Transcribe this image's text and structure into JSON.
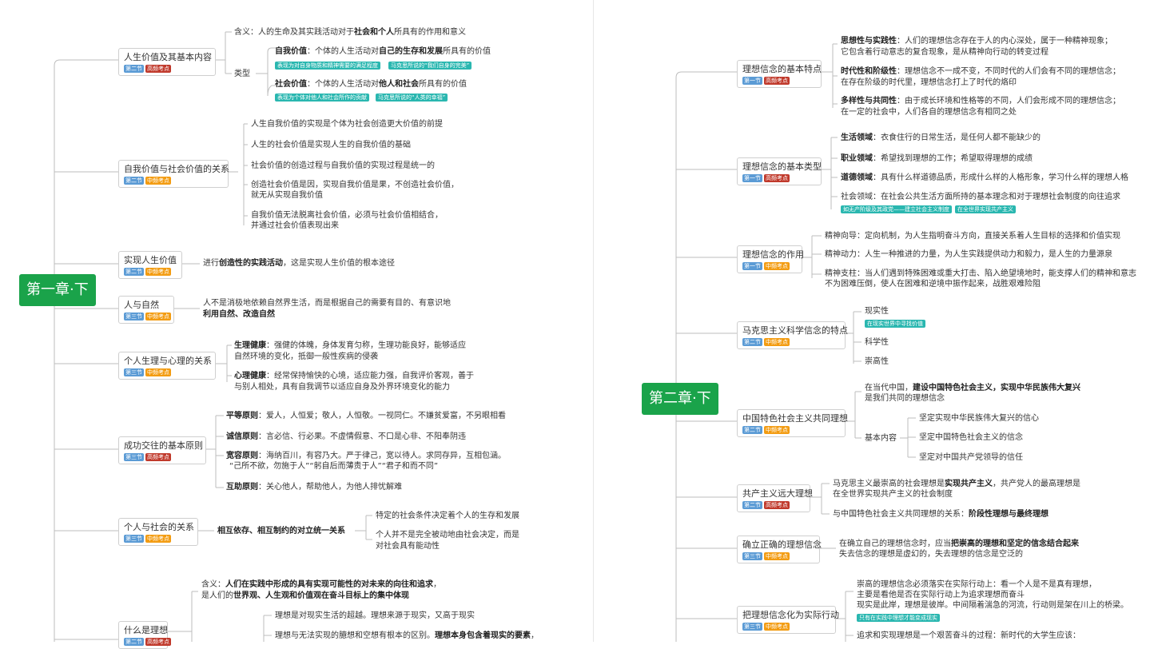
{
  "badges": {
    "s1": "第一节",
    "s2": "第二节",
    "s3": "第三节",
    "high": "高频考点",
    "mid": "中频考点"
  },
  "colors": {
    "root": "#1aa34a",
    "high": "#c0392b",
    "mid": "#f39c12",
    "section": "#5b9bd5",
    "tag": "#2ab7b0"
  },
  "left": {
    "root": "第一章·下",
    "n1": {
      "title": "人生价值及其基本内容",
      "meaning_pre": "含义：人的生命及其实践活动对于",
      "meaning_bold": "社会和个人",
      "meaning_post": "所具有的作用和意义",
      "types_label": "类型",
      "self_bold": "自我价值",
      "self_mid": "：个体的人生活动对",
      "self_bold2": "自己的生存和发展",
      "self_post": "所具有的价值",
      "self_tag1": "表现为对自身物质和精神需要的满足程度",
      "self_tag2": "马克思所说的“我们自身的完美”",
      "soc_bold": "社会价值",
      "soc_mid": "：个体的人生活动对",
      "soc_bold2": "他人和社会",
      "soc_post": "所具有的价值",
      "soc_tag1": "表现为个体对他人和社会所作的贡献",
      "soc_tag2": "马克思所说的“人类的幸福”"
    },
    "n2": {
      "title": "自我价值与社会价值的关系",
      "i1": "人生自我价值的实现是个体为社会创造更大价值的前提",
      "i2": "人生的社会价值是实现人生的自我价值的基础",
      "i3": "社会价值的创造过程与自我价值的实现过程是统一的",
      "i4a": "创造社会价值是因，实现自我价值是果，不创造社会价值，",
      "i4b": "就无从实现自我价值",
      "i5a": "自我价值无法脱离社会价值，必须与社会价值相结合，",
      "i5b": "并通过社会价值表现出来"
    },
    "n3": {
      "title": "实现人生价值",
      "pre": "进行",
      "bold": "创造性的实践活动",
      "post": "，这是实现人生价值的根本途径"
    },
    "n4": {
      "title": "人与自然",
      "l1": "人不是消极地依赖自然界生活，而是根据自己的需要有目的、有意识地",
      "l2": "利用自然、改造自然"
    },
    "n5": {
      "title": "个人生理与心理的关系",
      "a_bold": "生理健康",
      "a_l1": "：强健的体魄，身体发育匀称，生理功能良好，能够适应",
      "a_l2": "自然环境的变化，抵御一般性疾病的侵袭",
      "b_bold": "心理健康",
      "b_l1": "：经常保持愉快的心境，适应能力强，自我评价客观，善于",
      "b_l2": "与别人相处，具有自我调节以适应自身及外界环境变化的能力"
    },
    "n6": {
      "title": "成功交往的基本原则",
      "p1_bold": "平等原则",
      "p1": "：爱人，人恒爱；敬人，人恒敬。一视同仁。不嫌贫爱富，不另眼相看",
      "p2_bold": "诚信原则",
      "p2": "：言必信、行必果。不虚情假意、不口是心非、不阳奉阴违",
      "p3_bold": "宽容原则",
      "p3": "：海纳百川，有容乃大。严于律己，宽以待人。求同存异，互相包涵。",
      "p3b": "“己所不欲，勿施于人”“躬自后而薄责于人”“君子和而不同”",
      "p4_bold": "互助原则",
      "p4": "：关心他人，帮助他人，为他人排忧解难"
    },
    "n7": {
      "title": "个人与社会的关系",
      "mid": "相互依存、相互制约的对立统一关系",
      "i1": "特定的社会条件决定着个人的生存和发展",
      "i2a": "个人并不是完全被动地由社会决定，而是",
      "i2b": "对社会具有能动性"
    },
    "n8": {
      "title": "什么是理想",
      "m_pre": "含义：",
      "m_bold": "人们在实践中形成的具有实现可能性的对未来的向往和追求",
      "m_post": "，",
      "m2_pre": "是人们的",
      "m2_bold": "世界观、人生观和价值观在奋斗目标上的集中体现",
      "i1": "理想是对现实生活的超越。理想来源于现实，又高于现实",
      "i2_pre": "理想与无法实现的臆想和空想有根本的区别。",
      "i2_bold": "理想本身包含着现实的要素",
      "i2_post": "，"
    }
  },
  "right": {
    "root": "第二章·下",
    "m1": {
      "title": "理想信念的基本特点",
      "a_bold": "思想性与实践性",
      "a1": "：人们的理想信念存在于人的内心深处，属于一种精神现象；",
      "a2": "它包含着行动意志的复合现象，是从精神向行动的转变过程",
      "b_bold": "时代性和阶级性",
      "b1": "：理想信念不一成不变，不同时代的人们会有不同的理想信念；",
      "b2": "在存在阶级的时代里，理想信念打上了时代的烙印",
      "c_bold": "多样性与共同性",
      "c1": "：由于成长环境和性格等的不同，人们会形成不同的理想信念；",
      "c2": "在一定的社会中，人们各自的理想信念有相同之处"
    },
    "m2": {
      "title": "理想信念的基本类型",
      "a_bold": "生活领域",
      "a": "：衣食住行的日常生活，是任何人都不能缺少的",
      "b_bold": "职业领域",
      "b": "：希望找到理想的工作；希望取得理想的成绩",
      "c_bold": "道德领域",
      "c": "：具有什么样道德品质，形成什么样的人格形象，学习什么样的理想人格",
      "d": "社会领域：在社会公共生活方面所持的基本理念和对于理想社会制度的向往追求",
      "tag1": "如无产阶级及其政党——建立社会主义制度",
      "tag2": "在全世界实现共产主义"
    },
    "m3": {
      "title": "理想信念的作用",
      "a": "精神向导：定向机制，为人生指明奋斗方向，直接关系着人生目标的选择和价值实现",
      "b": "精神动力：人生一种推进的力量，为人生实践提供动力和毅力，是人生的力量源泉",
      "c1": "精神支柱：当人们遇到特殊困难或重大打击、陷入绝望境地时，能支撑人们的精神和意志",
      "c2": "不为困难压倒，使人在困难和逆境中振作起来，战胜艰难险阻"
    },
    "m4": {
      "title": "马克思主义科学信念的特点",
      "a": "现实性",
      "tag": "在现实世界中寻找价值",
      "b": "科学性",
      "c": "崇高性"
    },
    "m5": {
      "title": "中国特色社会主义共同理想",
      "a_pre": "在当代中国，",
      "a_bold": "建设中国特色社会主义，实现中华民族伟大复兴",
      "a2": "是我们共同的理想信念",
      "basic": "基本内容",
      "k1": "坚定实现中华民族伟大复兴的信心",
      "k2": "坚定中国特色社会主义的信念",
      "k3": "坚定对中国共产党领导的信任"
    },
    "m6": {
      "title": "共产主义远大理想",
      "a_pre": "马克思主义最崇高的社会理想是",
      "a_bold": "实现共产主义",
      "a_post": "，共产党人的最高理想是",
      "a2": "在全世界实现共产主义的社会制度",
      "b_pre": "与中国特色社会主义共同理想的关系：",
      "b_bold": "阶段性理想与最终理想"
    },
    "m7": {
      "title": "确立正确的理想信念",
      "a_pre": "在确立自己的理想信念时，应当",
      "a_bold": "把崇高的理想和坚定的信念结合起来",
      "a2": "失去信念的理想是虚幻的，失去理想的信念是空泛的"
    },
    "m8": {
      "title": "把理想信念化为实际行动",
      "a1": "崇高的理想信念必须落实在实际行动上：看一个人是不是真有理想，",
      "a2": "主要是看他是否在实际行动上为追求理想而奋斗",
      "a3": "现实是此岸，理想是彼岸。中间隔着湍急的河流，行动则是架在川上的桥梁。",
      "tag": "只有在实践中理想才能变成现实",
      "b": "追求和实现理想是一个艰苦奋斗的过程：新时代的大学生应该："
    }
  }
}
